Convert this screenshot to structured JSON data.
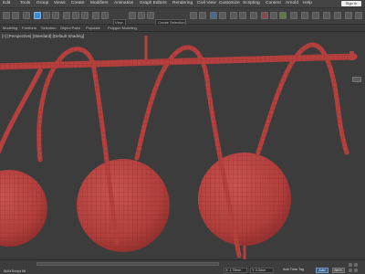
{
  "menubar": {
    "items": [
      "Edit",
      "Tools",
      "Group",
      "Views",
      "Create",
      "Modifiers",
      "Animation",
      "Graph Editors",
      "Rendering",
      "Civil View",
      "Customize",
      "Scripting",
      "Content",
      "Arnold",
      "Help"
    ],
    "sign_in_label": "Sign In"
  },
  "toolbar": {
    "view_dropdown": "View",
    "selection_set_placeholder": "Create Selection Se"
  },
  "subtoolbar": {
    "tabs": [
      "Modeling",
      "Freeform",
      "Selection",
      "Object Paint",
      "Populate"
    ],
    "ribbon_label": "Polygon Modeling"
  },
  "viewport": {
    "label": "[+] [Perspective] [Standard] [Default Shading]"
  },
  "statusbar": {
    "script_label": "MAXScript Mi",
    "x_value": "X: 1.79mm",
    "y_value": "Y: 0.0mm",
    "add_time_tag": "Add Time Tag",
    "autokey_label": "Auto",
    "setkey_label": "Set K."
  },
  "colors": {
    "object_fill": "#b5403e",
    "wire": "#7c2624",
    "background": "#3c3c3c"
  }
}
